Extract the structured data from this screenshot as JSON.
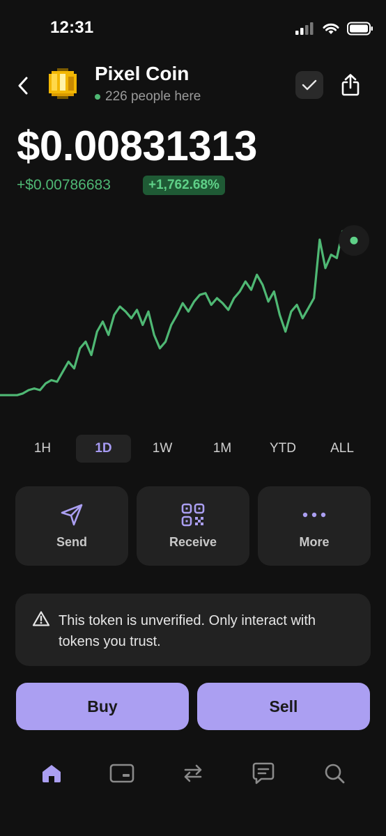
{
  "status_bar": {
    "time": "12:31"
  },
  "header": {
    "coin_name": "Pixel Coin",
    "presence": "226 people here"
  },
  "price": {
    "current": "$0.00831313",
    "change": "+$0.00786683",
    "change_pct": "+1,762.68%"
  },
  "colors": {
    "accent": "#ab9ff2",
    "positive": "#4fb874",
    "background": "#111111",
    "card": "#222222"
  },
  "chart_data": {
    "type": "line",
    "trend": [
      0.02,
      0.02,
      0.02,
      0.02,
      0.03,
      0.05,
      0.06,
      0.05,
      0.09,
      0.11,
      0.1,
      0.16,
      0.22,
      0.18,
      0.3,
      0.34,
      0.26,
      0.4,
      0.46,
      0.38,
      0.5,
      0.55,
      0.52,
      0.48,
      0.53,
      0.44,
      0.52,
      0.38,
      0.3,
      0.34,
      0.44,
      0.5,
      0.57,
      0.52,
      0.58,
      0.62,
      0.63,
      0.56,
      0.6,
      0.57,
      0.53,
      0.6,
      0.64,
      0.7,
      0.65,
      0.74,
      0.68,
      0.58,
      0.64,
      0.5,
      0.4,
      0.52,
      0.56,
      0.48,
      0.54,
      0.6,
      0.95,
      0.78,
      0.86,
      0.84,
      1.0,
      0.92,
      0.97
    ]
  },
  "timeframes": [
    {
      "label": "1H",
      "active": false
    },
    {
      "label": "1D",
      "active": true
    },
    {
      "label": "1W",
      "active": false
    },
    {
      "label": "1M",
      "active": false
    },
    {
      "label": "YTD",
      "active": false
    },
    {
      "label": "ALL",
      "active": false
    }
  ],
  "actions": [
    {
      "label": "Send",
      "icon": "send-icon"
    },
    {
      "label": "Receive",
      "icon": "qr-code-icon"
    },
    {
      "label": "More",
      "icon": "more-dots-icon"
    }
  ],
  "warning": {
    "icon": "warning-triangle-icon",
    "text": "This token is unverified. Only interact with tokens you trust."
  },
  "trade": {
    "buy_label": "Buy",
    "sell_label": "Sell"
  },
  "bottom_nav": [
    {
      "icon": "home-icon",
      "active": true
    },
    {
      "icon": "wallet-card-icon",
      "active": false
    },
    {
      "icon": "swap-icon",
      "active": false
    },
    {
      "icon": "messages-icon",
      "active": false
    },
    {
      "icon": "search-icon",
      "active": false
    }
  ]
}
